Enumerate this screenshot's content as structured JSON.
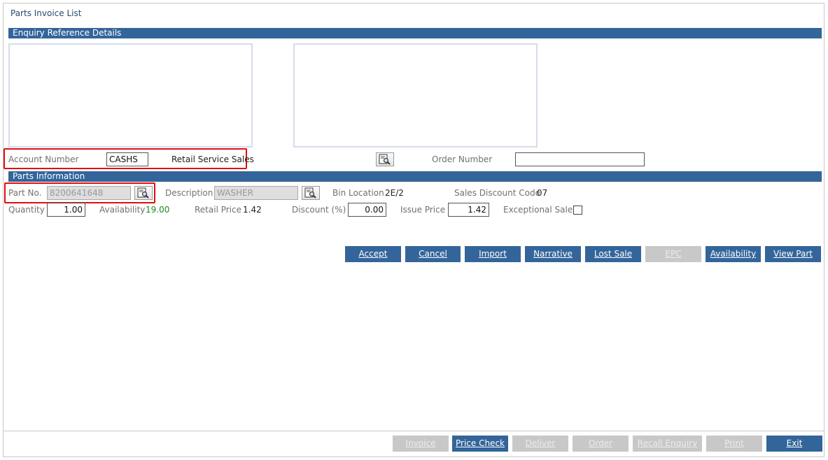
{
  "page": {
    "title": "Parts Invoice List"
  },
  "sections": {
    "enquiry": "Enquiry Reference Details",
    "parts": "Parts Information"
  },
  "account": {
    "label": "Account Number",
    "value": "CASHS",
    "name": "Retail Service Sales",
    "order_label": "Order Number",
    "order_value": ""
  },
  "part": {
    "part_no_label": "Part No.",
    "part_no_value": "8200641648",
    "description_label": "Description",
    "description_value": "WASHER",
    "bin_label": "Bin Location",
    "bin_value": "2E/2",
    "sales_discount_label": "Sales Discount Code",
    "sales_discount_value": "07",
    "quantity_label": "Quantity",
    "quantity_value": "1.00",
    "availability_label": "Availability",
    "availability_value": "19.00",
    "retail_price_label": "Retail Price",
    "retail_price_value": "1.42",
    "discount_label": "Discount (%)",
    "discount_value": "0.00",
    "issue_price_label": "Issue Price",
    "issue_price_value": "1.42",
    "exceptional_label": "Exceptional Sale",
    "exceptional_checked": false
  },
  "actions": {
    "accept": "Accept",
    "cancel": "Cancel",
    "import": "Import",
    "narrative": "Narrative",
    "lost_sale": "Lost Sale",
    "epc": "EPC",
    "availability": "Availability",
    "view_part": "View Part"
  },
  "footer": {
    "invoice": "Invoice",
    "price_check": "Price Check",
    "deliver": "Deliver",
    "order": "Order",
    "recall_enquiry": "Recall Enquiry",
    "print": "Print",
    "exit": "Exit"
  },
  "icons": {
    "lookup": "search-document-icon"
  },
  "colors": {
    "accent": "#33659a",
    "highlight": "#e20e0e",
    "availability": "#1b8a1b",
    "disabled": "#c8c8c8"
  }
}
